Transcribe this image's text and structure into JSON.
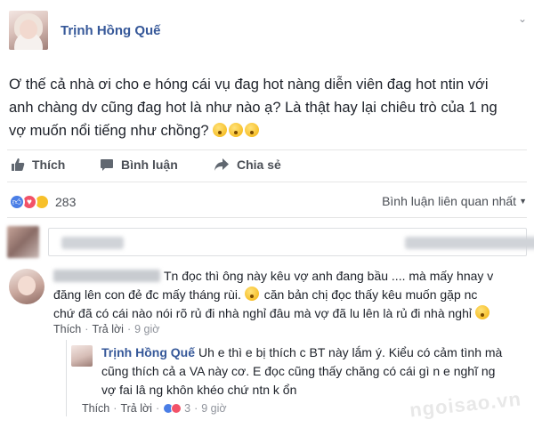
{
  "post": {
    "author": "Trịnh Hồng Quế",
    "text_lines": [
      "Ơ thế cả nhà ơi cho e hóng cái vụ đag hot nàng diễn viên đag hot ntin với",
      "anh chàng dv cũng đag hot là như nào ạ? Là thật hay lại chiêu trò của 1 ng",
      "vợ muốn nổi tiếng như chồng?"
    ]
  },
  "actions": {
    "like": "Thích",
    "comment": "Bình luận",
    "share": "Chia sẻ"
  },
  "reactions": {
    "count": "283"
  },
  "sort_label": "Bình luận liên quan nhất",
  "comment_1": {
    "lines": [
      "Tn đọc thì ông này kêu vợ anh đang bầu .... mà mấy hnay v",
      "đăng lên con đẻ đc mấy tháng rùi.",
      "căn bản chị đọc thấy kêu muốn gặp nc",
      "chứ đã có cái nào nói rõ rủ đi nhà nghỉ đâu mà vợ đã lu lên là rủ đi nhà nghỉ"
    ],
    "meta": {
      "like": "Thích",
      "reply": "Trả lời",
      "time": "9 giờ"
    }
  },
  "reply_1": {
    "author": "Trịnh Hồng Quế",
    "lines": [
      "Uh e thì e bị thích c BT này lắm ý. Kiểu có cảm tình mà",
      "cũng thích cả a VA này cơ. E đọc cũng thấy chăng có cái gì n e nghĩ ng",
      "vợ fai lâ ng khôn khéo chứ ntn k ổn"
    ],
    "meta": {
      "like": "Thích",
      "reply": "Trả lời",
      "react_count": "3",
      "time": "9 giờ"
    }
  },
  "watermark": "ngoisao.vn",
  "colors": {
    "link": "#365899",
    "like_blue": "#4a7ee6",
    "love_red": "#f25268",
    "haha_yellow": "#f7c02a"
  }
}
